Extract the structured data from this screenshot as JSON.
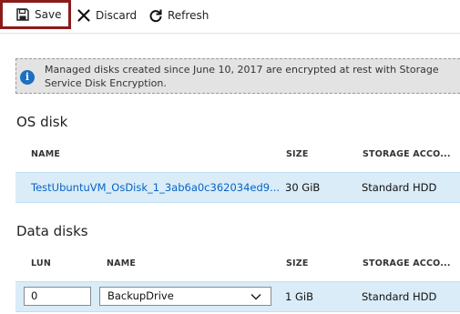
{
  "toolbar": {
    "save_label": "Save",
    "discard_label": "Discard",
    "refresh_label": "Refresh"
  },
  "info": {
    "text": "Managed disks created since June 10, 2017 are encrypted at rest with Storage Service Disk Encryption."
  },
  "os_disk": {
    "title": "OS disk",
    "columns": {
      "name": "NAME",
      "size": "SIZE",
      "storage": "STORAGE ACCO..."
    },
    "row": {
      "name": "TestUbuntuVM_OsDisk_1_3ab6a0c362034ed9...",
      "size": "30 GiB",
      "storage": "Standard HDD"
    }
  },
  "data_disks": {
    "title": "Data disks",
    "columns": {
      "lun": "LUN",
      "name": "NAME",
      "size": "SIZE",
      "storage": "STORAGE ACCO..."
    },
    "row": {
      "lun": "0",
      "name": "BackupDrive",
      "size": "1 GiB",
      "storage": "Standard HDD"
    }
  },
  "colors": {
    "accent": "#0a62c2",
    "selected_row": "#d9ecf8",
    "save_highlight": "#8b1a1a"
  }
}
